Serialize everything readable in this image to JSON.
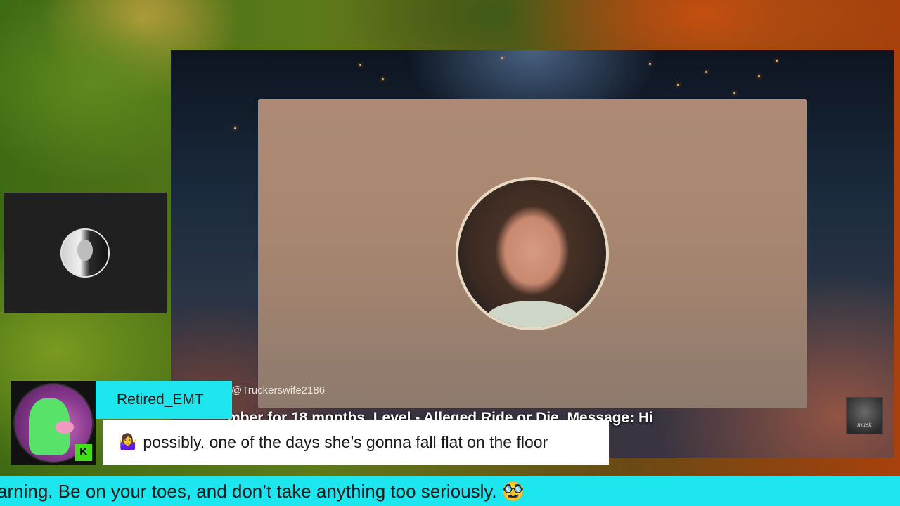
{
  "main_alert": {
    "handle": "@Truckerswife2186",
    "subscription_line": "mber for 18 months. Level - Alleged Ride or Die. Message: Hi"
  },
  "chat": {
    "username": "Retired_EMT",
    "badge_letter": "K",
    "message_emoji": "🤷‍♀️",
    "message_text": "possibly. one of the days she’s gonna fall flat on the floor"
  },
  "ticker": {
    "text": "arning. Be on your toes, and don’t take anything too seriously. 🥸"
  },
  "colors": {
    "accent_cyan": "#1ee6ee",
    "kick_green": "#3fe018"
  },
  "icons": {
    "webcam_avatar": "webcam-avatar-icon",
    "chat_avatar": "chat-user-avatar-icon",
    "kick_badge": "kick-platform-badge-icon"
  }
}
